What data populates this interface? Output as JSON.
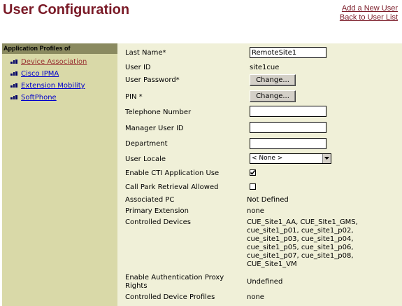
{
  "header": {
    "title": "User Configuration",
    "links": [
      "Add a New User",
      "Back to User List"
    ]
  },
  "sidebar": {
    "heading": "Application Profiles of",
    "items": [
      {
        "label": "Device Association",
        "icon": "link-icon"
      },
      {
        "label": "Cisco IPMA",
        "icon": "link-icon"
      },
      {
        "label": "Extension Mobility",
        "icon": "link-icon"
      },
      {
        "label": "SoftPhone",
        "icon": "link-icon"
      }
    ]
  },
  "form": {
    "last_name_label": "Last Name*",
    "last_name_value": "RemoteSite1",
    "user_id_label": "User ID",
    "user_id_value": "site1cue",
    "password_label": "User Password*",
    "password_button": "Change...",
    "pin_label": "PIN *",
    "pin_button": "Change...",
    "telephone_label": "Telephone Number",
    "telephone_value": "",
    "manager_label": "Manager User ID",
    "manager_value": "",
    "department_label": "Department",
    "department_value": "",
    "locale_label": "User Locale",
    "locale_value": "< None >",
    "cti_label": "Enable CTI Application Use",
    "cti_checked": true,
    "callpark_label": "Call Park Retrieval Allowed",
    "callpark_checked": false,
    "assoc_pc_label": "Associated PC",
    "assoc_pc_value": "Not Defined",
    "primary_ext_label": "Primary Extension",
    "primary_ext_value": "none",
    "controlled_devices_label": "Controlled Devices",
    "controlled_devices_lines": [
      "CUE_Site1_AA, CUE_SIte1_GMS,",
      "cue_site1_p01, cue_site1_p02,",
      "cue_site1_p03, cue_site1_p04,",
      "cue_site1_p05, cue_site1_p06,",
      "cue_site1_p07, cue_site1_p08,",
      "CUE_Site1_VM"
    ],
    "auth_proxy_label_line1": "Enable Authentication Proxy",
    "auth_proxy_label_line2": "Rights",
    "auth_proxy_value": "Undefined",
    "device_profiles_label": "Controlled Device Profiles",
    "device_profiles_value": "none"
  },
  "colors": {
    "title": "#7a1a27",
    "sidebar_bg": "#d9d9a8",
    "sidebar_header_bg": "#8a8a60",
    "main_bg": "#f0f0d8",
    "link": "#0000cc"
  }
}
